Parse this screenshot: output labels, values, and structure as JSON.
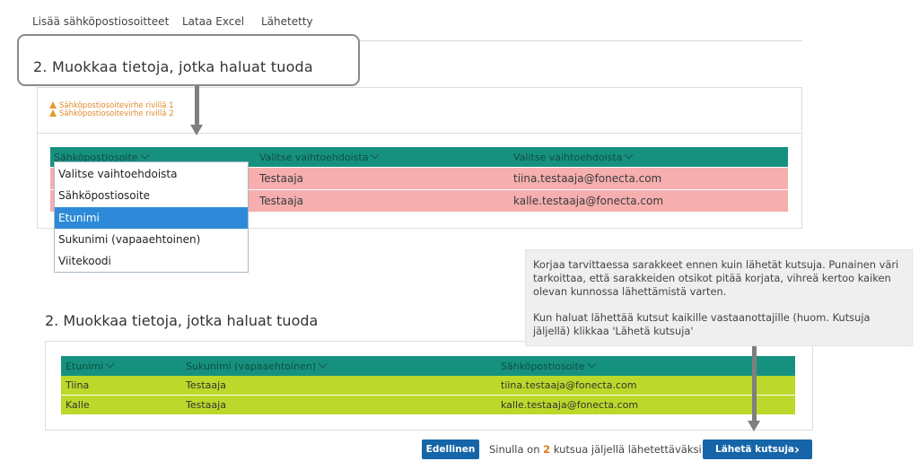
{
  "tabs": [
    {
      "label": "Lisää sähköpostiosoitteet"
    },
    {
      "label": "Lataa Excel"
    },
    {
      "label": "Lähetetty"
    }
  ],
  "callout": {
    "title": "2. Muokkaa tietoja, jotka haluat tuoda"
  },
  "errors": [
    "Sähköpostiosoitevirhe rivillä 1",
    "Sähköpostiosoitevirhe rivillä 2"
  ],
  "top_table": {
    "headers": [
      "Sähköpostiosoite",
      "Valitse vaihtoehdoista",
      "Valitse vaihtoehdoista"
    ],
    "rows": [
      {
        "c2": "Testaaja",
        "c3": "tiina.testaaja@fonecta.com"
      },
      {
        "c2": "Testaaja",
        "c3": "kalle.testaaja@fonecta.com"
      }
    ]
  },
  "dropdown": {
    "options": [
      "Valitse vaihtoehdoista",
      "Sähköpostiosoite",
      "Etunimi",
      "Sukunimi (vapaaehtoinen)",
      "Viitekoodi"
    ],
    "selected": "Etunimi"
  },
  "section2": {
    "title": "2. Muokkaa tietoja, jotka haluat tuoda"
  },
  "bottom_table": {
    "headers": [
      "Etunimi",
      "Sukunimi (vapaaehtoinen)",
      "Sähköpostiosoite"
    ],
    "rows": [
      [
        "Tiina",
        "Testaaja",
        "tiina.testaaja@fonecta.com"
      ],
      [
        "Kalle",
        "Testaaja",
        "kalle.testaaja@fonecta.com"
      ]
    ]
  },
  "tooltip": {
    "p1": "Korjaa tarvittaessa sarakkeet ennen kuin lähetät kutsuja. Punainen väri tarkoittaa, että sarakkeiden otsikot pitää korjata, vihreä kertoo kaiken olevan kunnossa lähettämistä varten.",
    "p2": "Kun haluat lähettää kutsut kaikille vastaanottajille (huom. Kutsuja jäljellä) klikkaa 'Lähetä kutsuja'"
  },
  "footer": {
    "prev_label": "Edellinen",
    "status_before": "Sinulla on",
    "count": "2",
    "status_after": "kutsua jäljellä lähetettäväksi",
    "send_label": "Lähetä kutsuja"
  },
  "colors": {
    "accent": "#17917f",
    "error_row": "#f6aeae",
    "ok_row": "#bcd82a",
    "button": "#1665a8",
    "selected": "#2e8ad8"
  }
}
